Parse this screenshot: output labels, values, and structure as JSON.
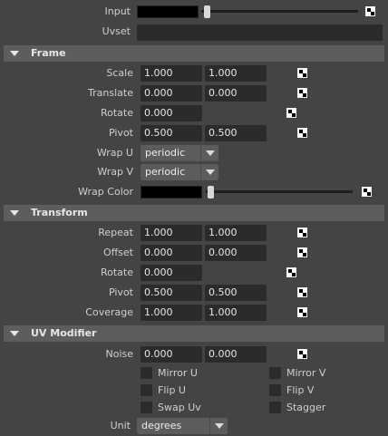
{
  "top": {
    "input_label": "Input",
    "uvset_label": "Uvset",
    "uvset_value": ""
  },
  "frame": {
    "title": "Frame",
    "scale_label": "Scale",
    "scale": [
      "1.000",
      "1.000"
    ],
    "translate_label": "Translate",
    "translate": [
      "0.000",
      "0.000"
    ],
    "rotate_label": "Rotate",
    "rotate": "0.000",
    "pivot_label": "Pivot",
    "pivot": [
      "0.500",
      "0.500"
    ],
    "wrap_u_label": "Wrap U",
    "wrap_u": "periodic",
    "wrap_v_label": "Wrap V",
    "wrap_v": "periodic",
    "wrap_color_label": "Wrap Color"
  },
  "transform": {
    "title": "Transform",
    "repeat_label": "Repeat",
    "repeat": [
      "1.000",
      "1.000"
    ],
    "offset_label": "Offset",
    "offset": [
      "0.000",
      "0.000"
    ],
    "rotate_label": "Rotate",
    "rotate": "0.000",
    "pivot_label": "Pivot",
    "pivot": [
      "0.500",
      "0.500"
    ],
    "coverage_label": "Coverage",
    "coverage": [
      "1.000",
      "1.000"
    ]
  },
  "uv_modifier": {
    "title": "UV Modifier",
    "noise_label": "Noise",
    "noise": [
      "0.000",
      "0.000"
    ],
    "mirror_u": "Mirror U",
    "mirror_v": "Mirror V",
    "flip_u": "Flip U",
    "flip_v": "Flip V",
    "swap_uv": "Swap Uv",
    "stagger": "Stagger",
    "unit_label": "Unit",
    "unit": "degrees"
  }
}
